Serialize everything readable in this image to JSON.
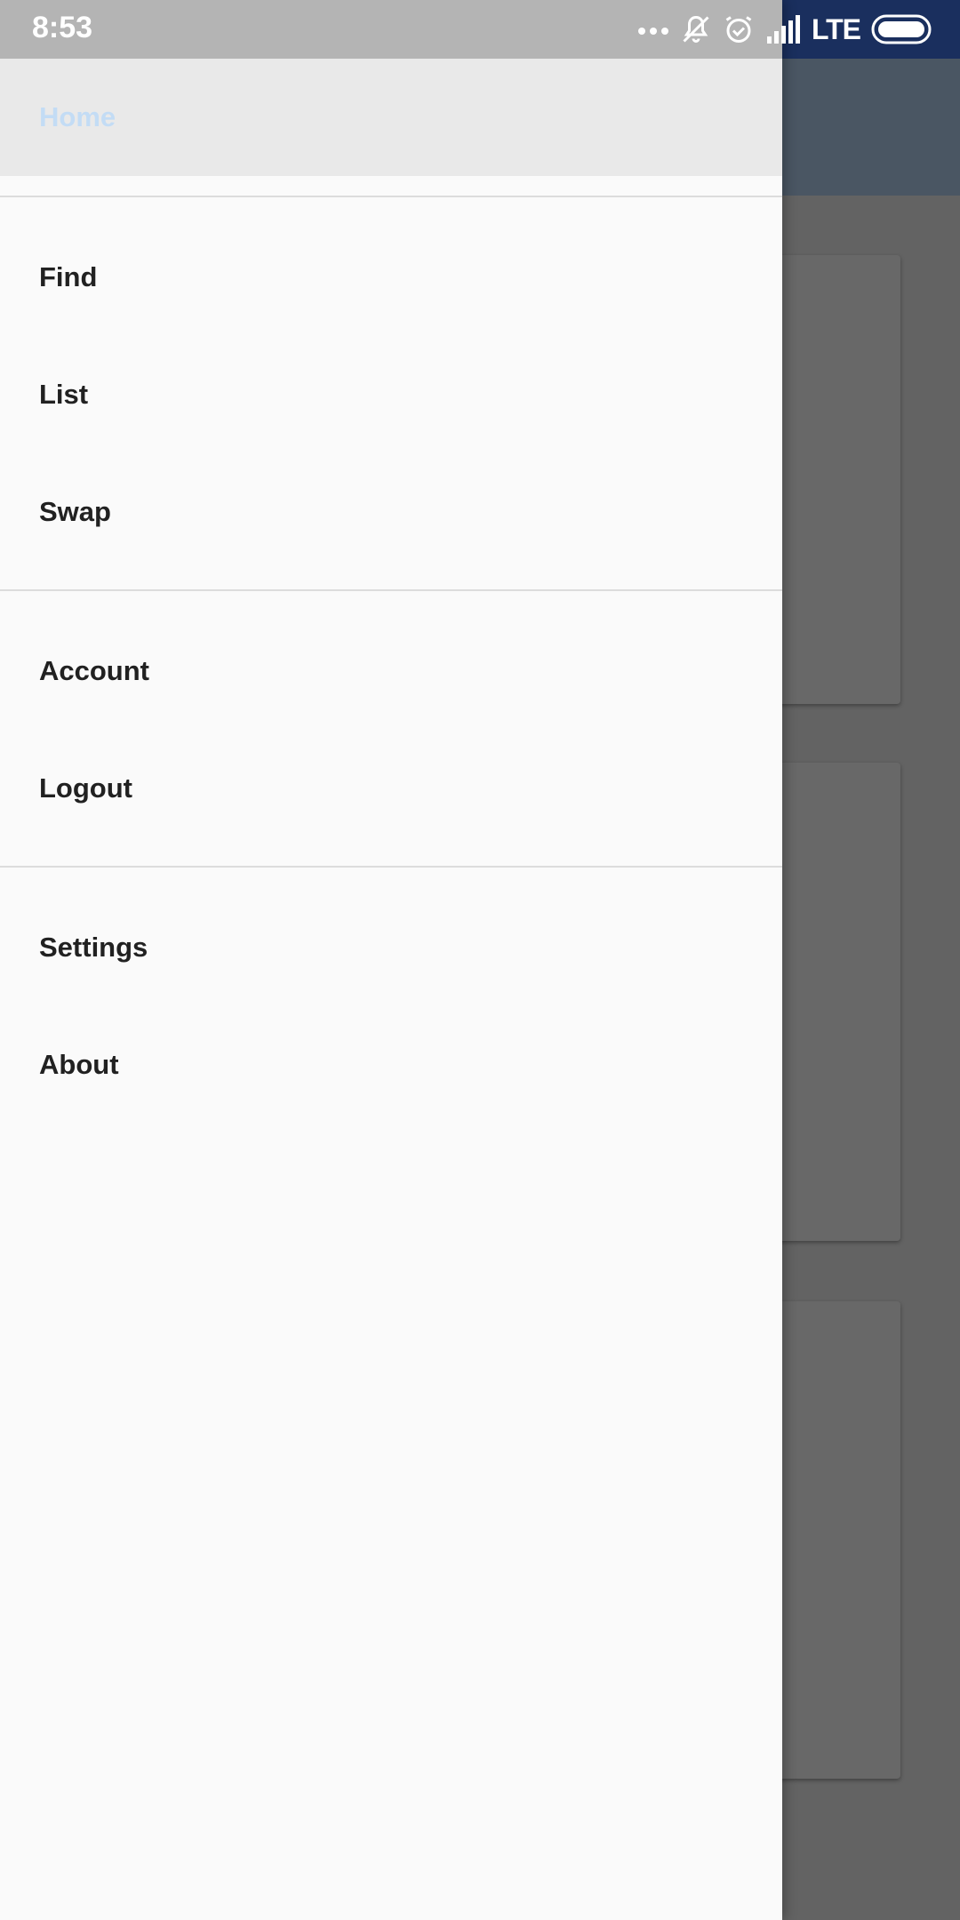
{
  "status_bar": {
    "time": "8:53",
    "network": "LTE",
    "icons": [
      "more-dots-icon",
      "notifications-off-icon",
      "alarm-icon",
      "signal-icon",
      "battery-icon"
    ]
  },
  "drawer": {
    "selected": "Home",
    "accent_color": "#c3dcf5",
    "groups": [
      {
        "items": [
          {
            "label": "Home"
          }
        ]
      },
      {
        "items": [
          {
            "label": "Find"
          },
          {
            "label": "List"
          },
          {
            "label": "Swap"
          }
        ]
      },
      {
        "items": [
          {
            "label": "Account"
          },
          {
            "label": "Logout"
          }
        ]
      },
      {
        "items": [
          {
            "label": "Settings"
          },
          {
            "label": "About"
          }
        ]
      }
    ]
  },
  "colors": {
    "app_bar": "#4a5663",
    "status_bar": "#1a2f5e",
    "scrim": "#626262",
    "drawer_bg": "#fafafa"
  }
}
